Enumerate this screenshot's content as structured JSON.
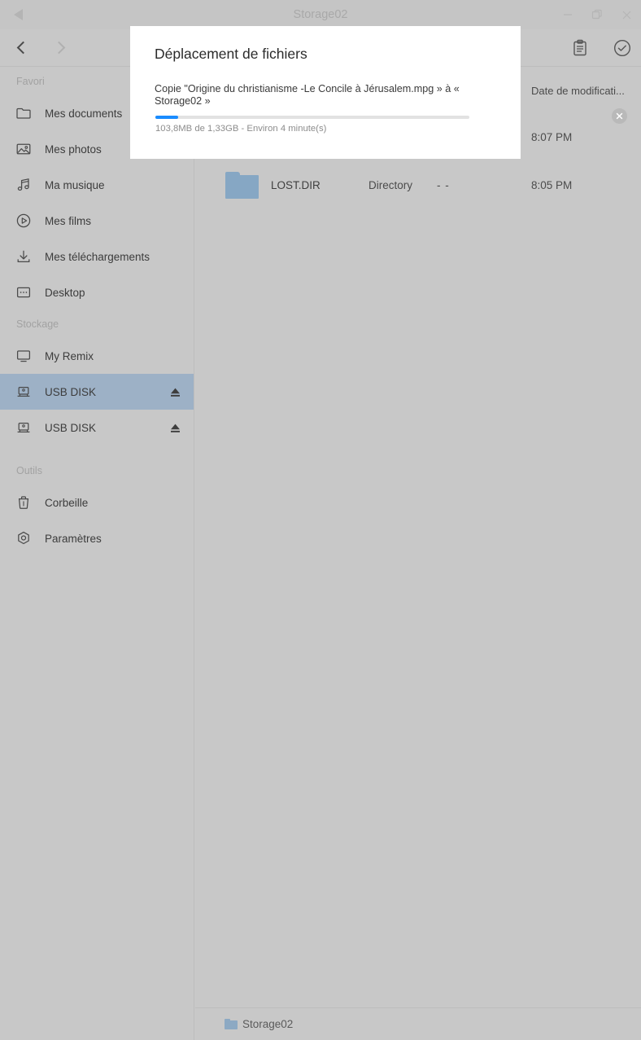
{
  "window": {
    "title": "Storage02",
    "back_icon": "back-triangle-icon",
    "minimize_icon": "minimize-icon",
    "restore_icon": "restore-icon",
    "close_icon": "close-icon"
  },
  "toolbar": {
    "back_icon": "chevron-left-icon",
    "forward_icon": "chevron-right-icon",
    "clipboard_icon": "clipboard-icon",
    "select_icon": "check-circle-icon"
  },
  "sidebar": {
    "sections": [
      {
        "title": "Favori",
        "items": [
          {
            "label": "Mes documents",
            "icon": "folder-icon",
            "selected": false,
            "eject": false
          },
          {
            "label": "Mes photos",
            "icon": "image-icon",
            "selected": false,
            "eject": false
          },
          {
            "label": "Ma musique",
            "icon": "music-note-icon",
            "selected": false,
            "eject": false
          },
          {
            "label": "Mes films",
            "icon": "play-circle-icon",
            "selected": false,
            "eject": false
          },
          {
            "label": "Mes téléchargements",
            "icon": "download-icon",
            "selected": false,
            "eject": false
          },
          {
            "label": "Desktop",
            "icon": "desktop-icon",
            "selected": false,
            "eject": false
          }
        ]
      },
      {
        "title": "Stockage",
        "items": [
          {
            "label": "My Remix",
            "icon": "monitor-icon",
            "selected": false,
            "eject": false
          },
          {
            "label": "USB DISK",
            "icon": "usb-drive-icon",
            "selected": true,
            "eject": true
          },
          {
            "label": "USB DISK",
            "icon": "usb-drive-icon",
            "selected": false,
            "eject": true
          }
        ]
      },
      {
        "title": "Outils",
        "items": [
          {
            "label": "Corbeille",
            "icon": "trash-icon",
            "selected": false,
            "eject": false
          },
          {
            "label": "Paramètres",
            "icon": "settings-icon",
            "selected": false,
            "eject": false
          }
        ]
      }
    ]
  },
  "filepane": {
    "columns": {
      "date": "Date de modificati..."
    },
    "rows": [
      {
        "name": "LOST.DIR",
        "type": "Directory",
        "size": "- -",
        "date": "8:05 PM",
        "icon": "folder-icon"
      }
    ],
    "hidden_row_date": "8:07 PM"
  },
  "statusbar": {
    "path_label": "Storage02",
    "icon": "folder-icon"
  },
  "dialog": {
    "title": "Déplacement de fichiers",
    "message": "Copie \"Origine du christianisme -Le Concile à Jérusalem.mpg » à « Storage02 »",
    "progress_percent": 7.3,
    "status": "103,8MB de 1,33GB - Environ 4 minute(s)",
    "cancel_icon": "close-circle-icon",
    "accent_color": "#1a8cff",
    "track_color": "#e2e2e2"
  },
  "colors": {
    "chrome": "#c8c8c8",
    "titlebar": "#c5c5c5",
    "selection": "#9db1c6",
    "folder": "#86a7c4",
    "dialog_bg": "#ffffff"
  }
}
